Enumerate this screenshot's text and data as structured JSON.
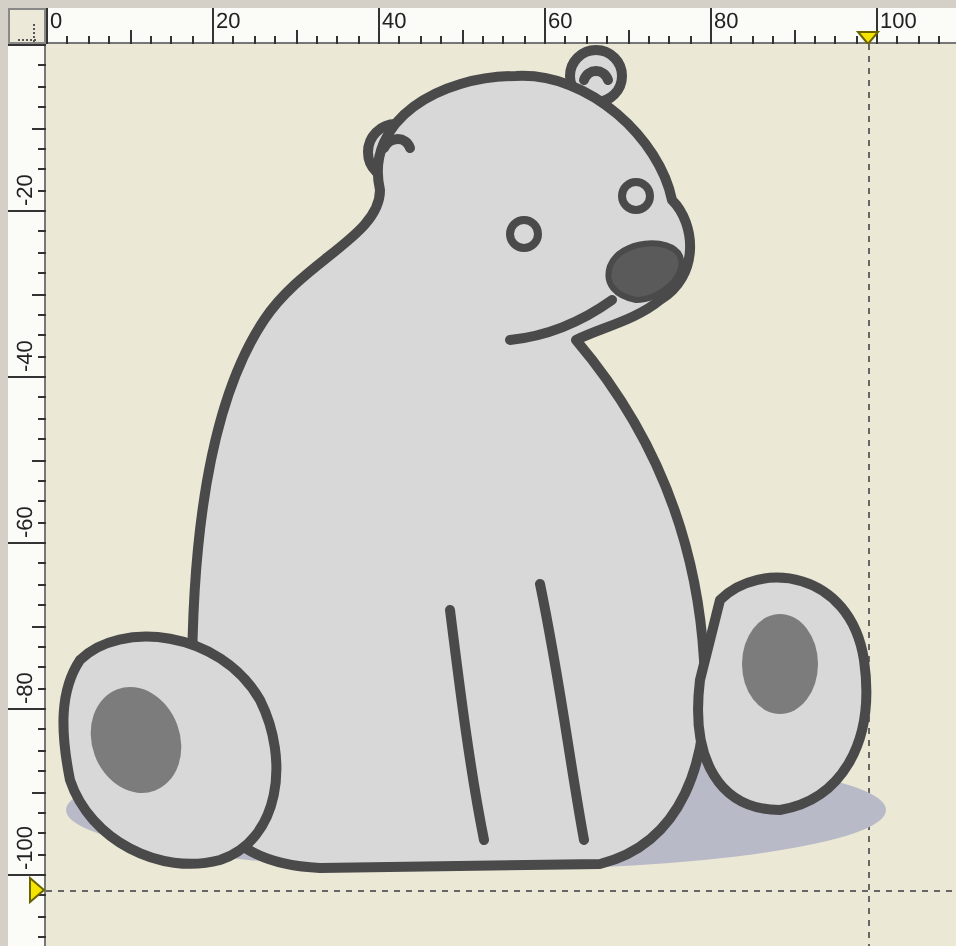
{
  "rulers": {
    "horizontal": {
      "labels": [
        "0",
        "20",
        "40",
        "60",
        "80",
        "100"
      ]
    },
    "vertical": {
      "labels": [
        "-20",
        "-40",
        "-60",
        "-80",
        "-100"
      ]
    }
  }
}
